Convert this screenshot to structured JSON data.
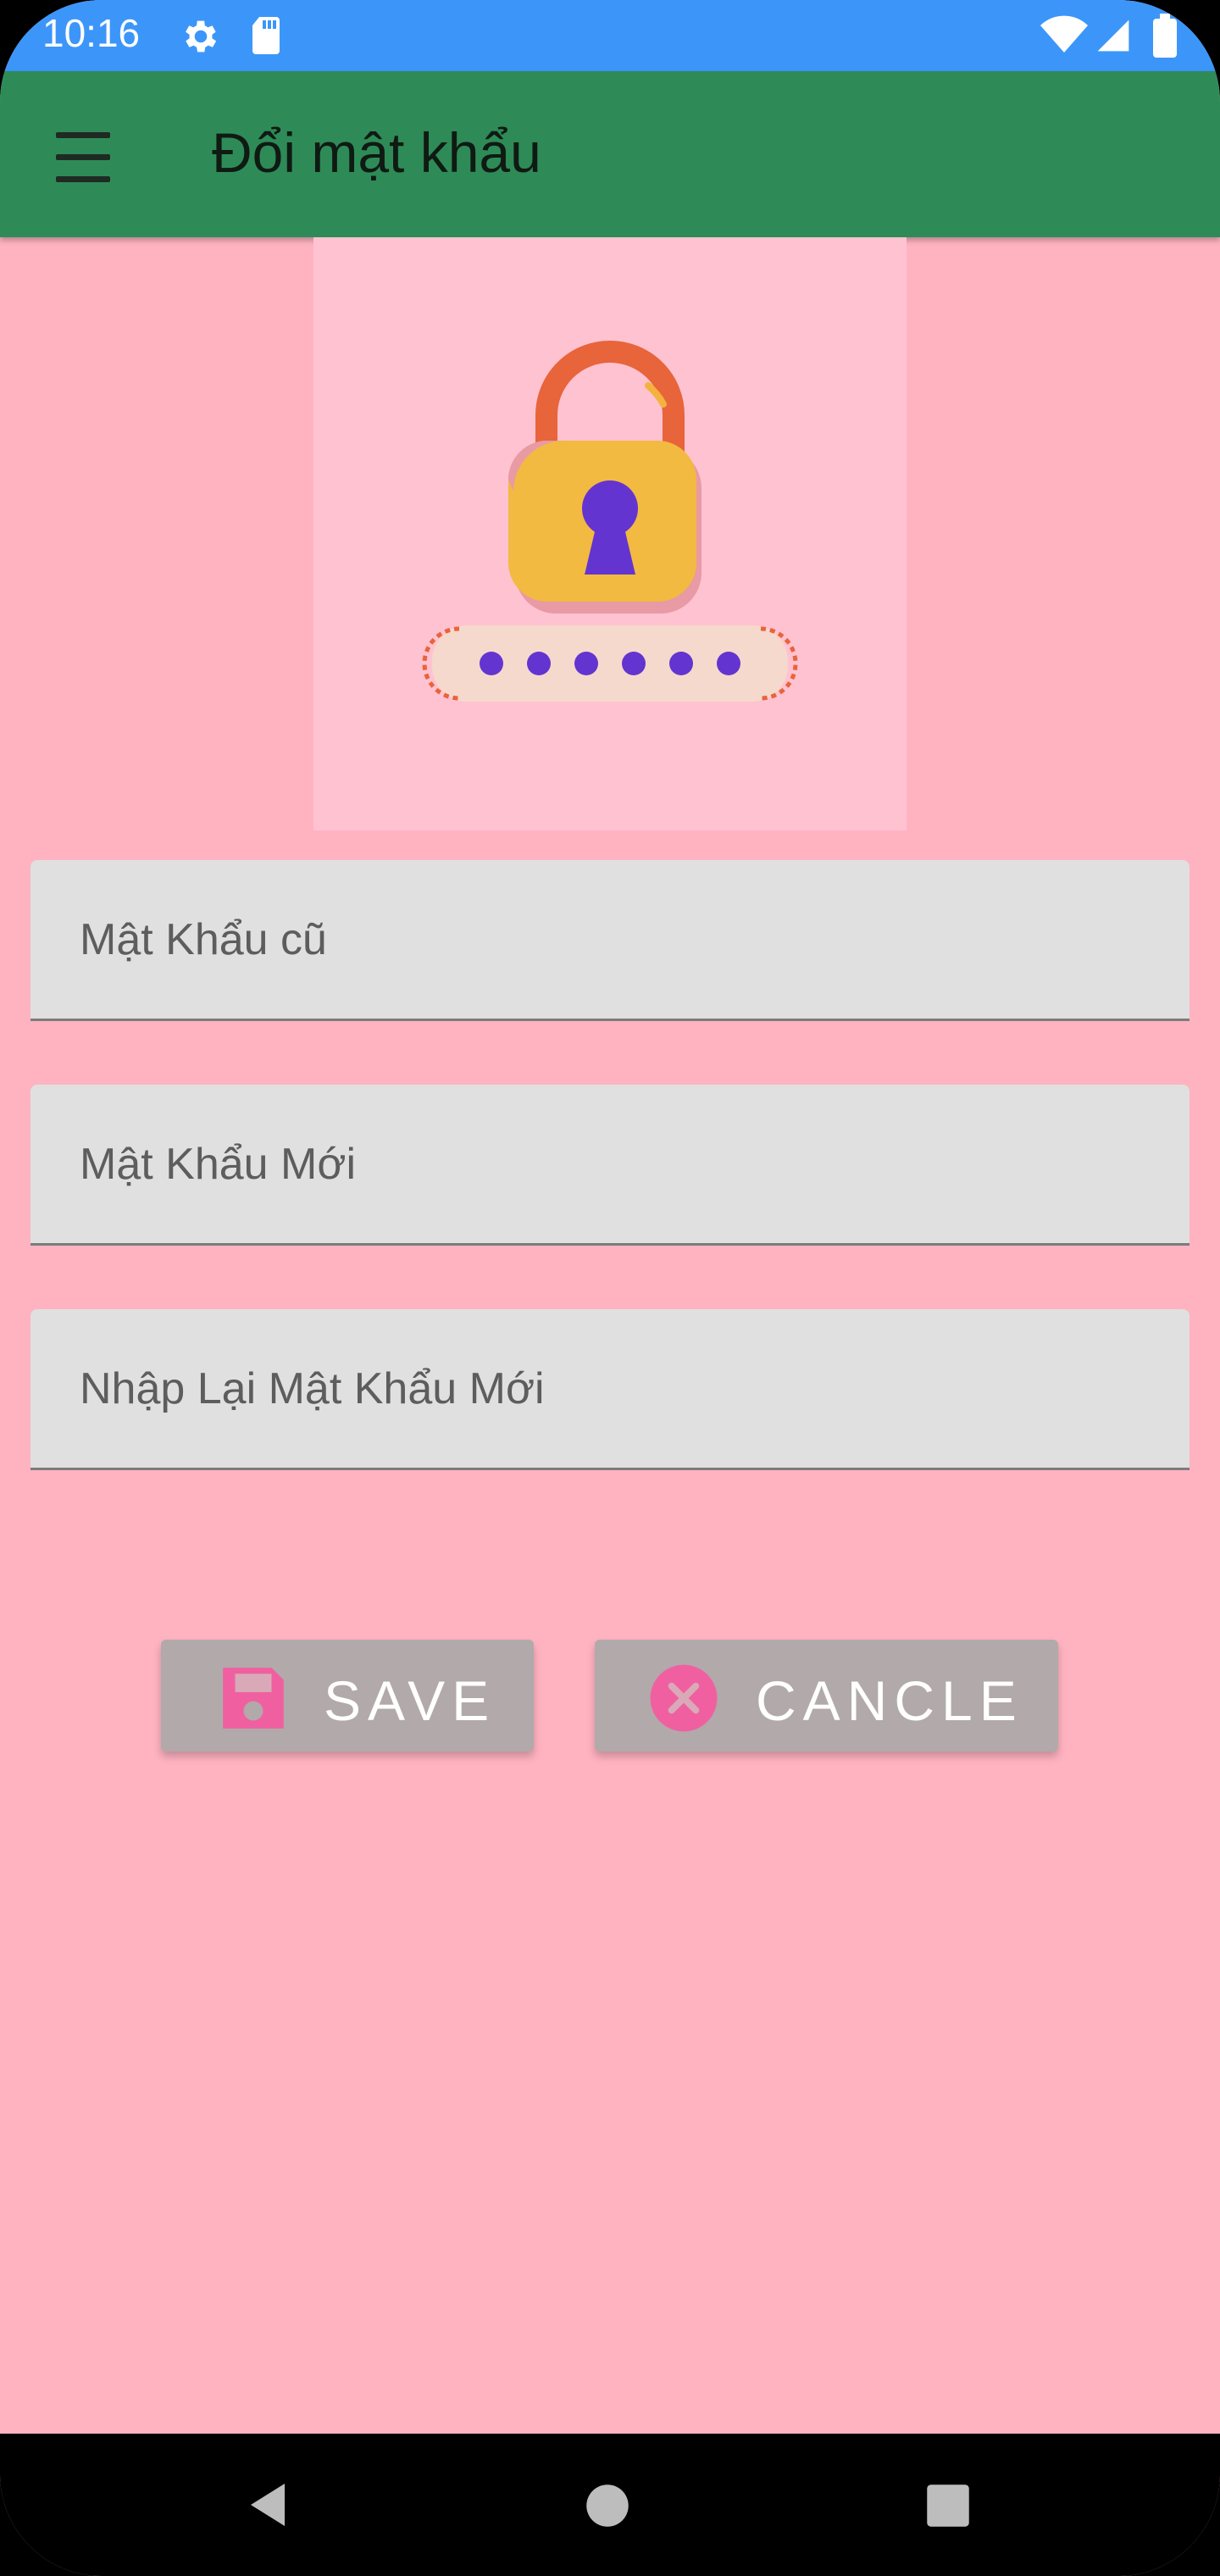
{
  "status_bar": {
    "time": "10:16",
    "icons": [
      "gear-icon",
      "sd-card-icon",
      "wifi-icon",
      "signal-icon",
      "battery-icon"
    ]
  },
  "app_bar": {
    "title": "Đổi mật khẩu",
    "menu_icon": "hamburger-menu-icon"
  },
  "illustration": {
    "icon": "password-lock-icon"
  },
  "form": {
    "old_password": {
      "placeholder": "Mật Khẩu cũ",
      "value": ""
    },
    "new_password": {
      "placeholder": "Mật Khẩu Mới",
      "value": ""
    },
    "confirm_password": {
      "placeholder": "Nhập Lại Mật Khẩu Mới",
      "value": ""
    }
  },
  "actions": {
    "save_label": "SAVE",
    "save_icon": "floppy-disk-icon",
    "cancel_label": "CANCLE",
    "cancel_icon": "cancel-circle-icon"
  },
  "nav_bar": {
    "icons": [
      "back-icon",
      "home-icon",
      "recent-apps-icon"
    ]
  },
  "colors": {
    "status_bar": "#3c96f9",
    "app_bar": "#2e8b57",
    "background": "#ffb3c1",
    "field_background": "#e0e0e0",
    "button_background": "#b2a9ab",
    "button_icon": "#f060a0"
  }
}
